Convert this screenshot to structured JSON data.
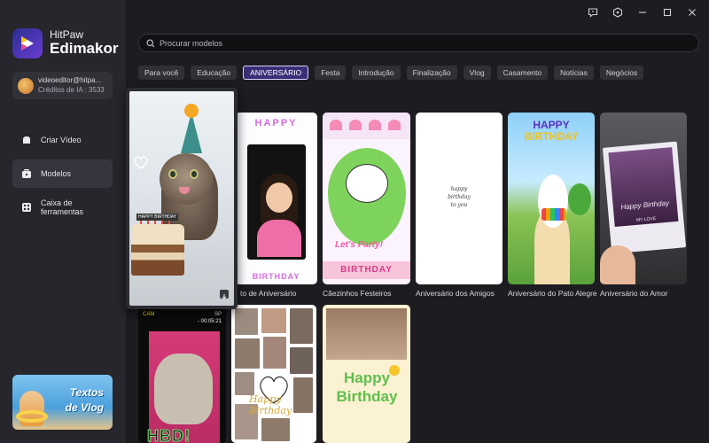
{
  "app": {
    "brand_line1": "HitPaw",
    "brand_line2": "Edimakor"
  },
  "account": {
    "email": "videoeditor@hitpa...",
    "credits": "Créditos de IA : 3533"
  },
  "nav": [
    {
      "label": "Criar Vídeo",
      "icon": "create-video-icon"
    },
    {
      "label": "Modelos",
      "icon": "templates-icon",
      "active": true
    },
    {
      "label": "Caixa de ferramentas",
      "icon": "toolbox-icon"
    }
  ],
  "promo": {
    "line1": "Textos",
    "line2": "de Vlog"
  },
  "search": {
    "placeholder": "Procurar modelos",
    "value": ""
  },
  "tabs": [
    {
      "label": "Para você"
    },
    {
      "label": "Educação"
    },
    {
      "label": "ANIVERSÁRIO",
      "active": true
    },
    {
      "label": "Festa"
    },
    {
      "label": "Introdução"
    },
    {
      "label": "Finalização"
    },
    {
      "label": "Vlog"
    },
    {
      "label": "Casamento"
    },
    {
      "label": "Notícias"
    },
    {
      "label": "Negócios"
    }
  ],
  "templates": [
    {
      "label": "to de Aniversário",
      "header": "HAPPY",
      "footer": "BIRTHDAY"
    },
    {
      "label": "Cãezinhos Festeiros",
      "text1": "Let's Party!",
      "text2": "BIRTHDAY"
    },
    {
      "label": "Aniversário dos Amigos",
      "text": "happy\nbirthday\nto you"
    },
    {
      "label": "Aniversário do Pato Alegre",
      "text1": "HAPPY",
      "text2": "BIRTHDAY"
    },
    {
      "label": "Aniversário do Amor",
      "text": "Happy Birthday",
      "text2": "MY LOVE"
    }
  ],
  "row2": [
    {
      "cam": "CAM",
      "sp": "SP",
      "time": "- 00:05:21",
      "big": "HBD!"
    },
    {
      "text": "Happy Birthday"
    },
    {
      "text1": "Happy",
      "text2": "Birthday"
    }
  ],
  "hover_card": {
    "cake_label": "HAPPY BIRTHDAY"
  }
}
